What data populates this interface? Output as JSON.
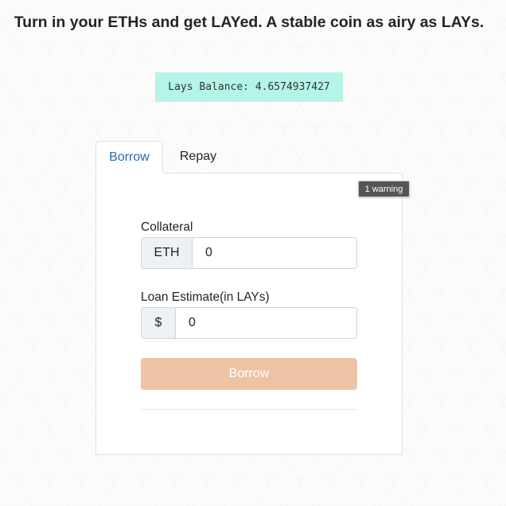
{
  "header": {
    "title": "Turn in your ETHs and get LAYed. A stable coin as airy as LAYs."
  },
  "balance": {
    "text": "Lays Balance: 4.6574937427"
  },
  "tabs": [
    {
      "label": "Borrow",
      "active": true
    },
    {
      "label": "Repay",
      "active": false
    }
  ],
  "warning": {
    "text": "1 warning"
  },
  "form": {
    "collateral": {
      "label": "Collateral",
      "addon": "ETH",
      "value": "0"
    },
    "loan": {
      "label": "Loan Estimate(in LAYs)",
      "addon": "$",
      "value": "0"
    },
    "submit_label": "Borrow"
  },
  "colors": {
    "accent_tab": "#2c6aa8",
    "balance_bg": "#b4f5e8",
    "button_disabled": "#eec3a5",
    "warning_bg": "#555555"
  }
}
